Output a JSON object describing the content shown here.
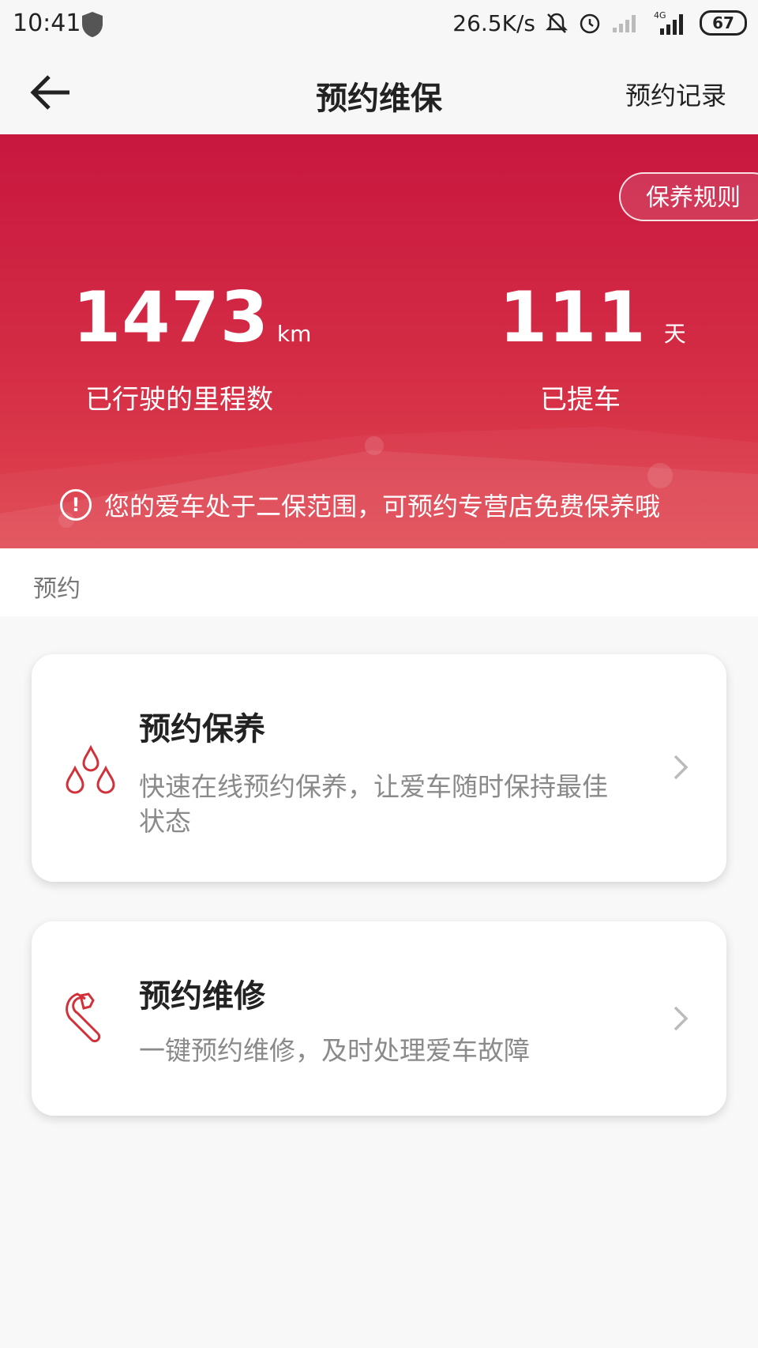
{
  "status_bar": {
    "time": "10:41",
    "net_speed": "26.5K/s",
    "network": "4G",
    "battery": "67",
    "icons": [
      "shield-icon",
      "mute-icon",
      "alarm-icon",
      "signal-icon",
      "battery-icon"
    ]
  },
  "nav": {
    "title": "预约维保",
    "right_label": "预约记录",
    "back_icon": "back-arrow-icon"
  },
  "hero": {
    "rules_label": "保养规则",
    "mileage": {
      "value": "1473",
      "unit": "km",
      "label": "已行驶的里程数"
    },
    "days": {
      "value": "111",
      "unit": "天",
      "label": "已提车"
    },
    "notice": "您的爱车处于二保范围，可预约专营店免费保养哦",
    "notice_icon": "!",
    "colors": {
      "top": "#c8173f",
      "bottom": "#e0464f"
    }
  },
  "section": {
    "title": "预约"
  },
  "cards": [
    {
      "title": "预约保养",
      "desc": "快速在线预约保养，让爱车随时保持最佳状态",
      "icon": "oil-drops-icon"
    },
    {
      "title": "预约维修",
      "desc": "一键预约维修，及时处理爱车故障",
      "icon": "wrench-icon"
    }
  ],
  "accent_color": "#d2313a"
}
